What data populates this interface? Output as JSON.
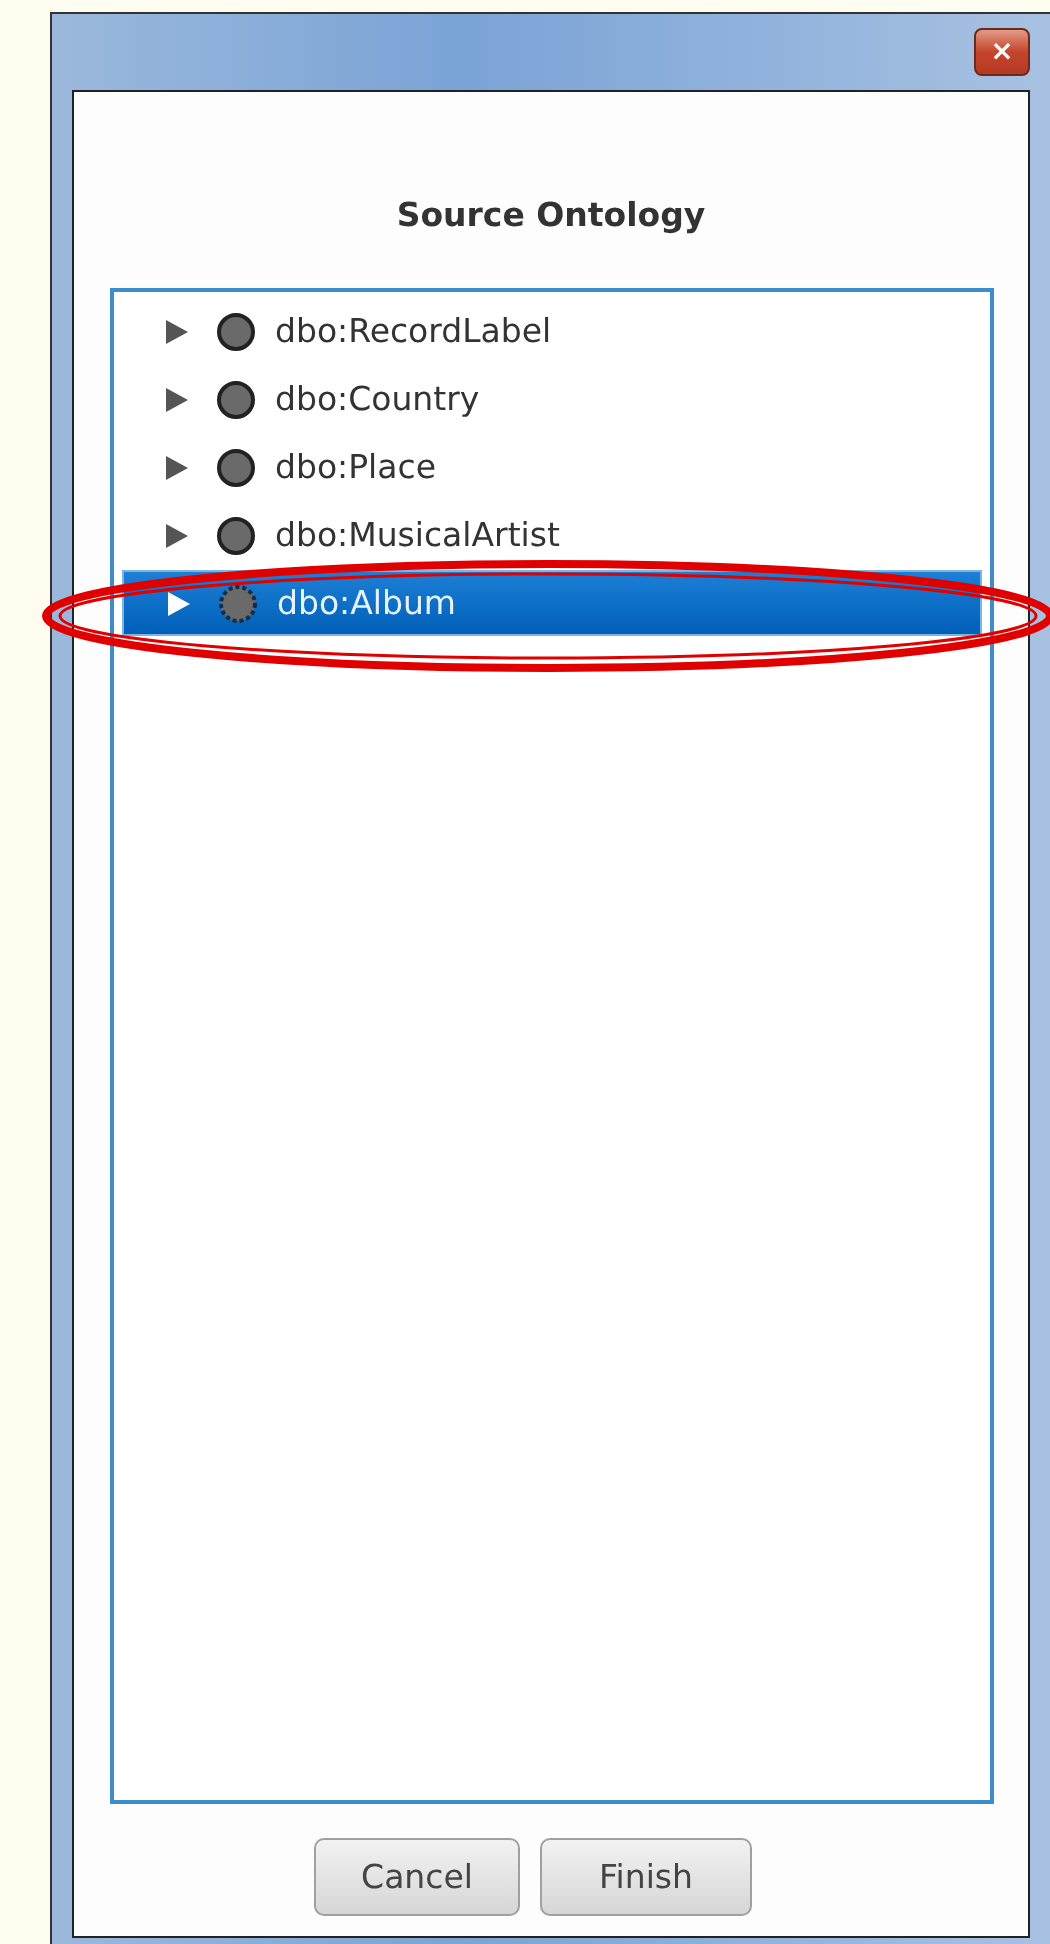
{
  "window": {
    "close_label": "×"
  },
  "title": "Source Ontology",
  "tree": {
    "items": [
      {
        "label": "dbo:RecordLabel",
        "selected": false
      },
      {
        "label": "dbo:Country",
        "selected": false
      },
      {
        "label": "dbo:Place",
        "selected": false
      },
      {
        "label": "dbo:MusicalArtist",
        "selected": false
      },
      {
        "label": "dbo:Album",
        "selected": true
      }
    ]
  },
  "buttons": [
    "Cancel",
    "Finish"
  ]
}
